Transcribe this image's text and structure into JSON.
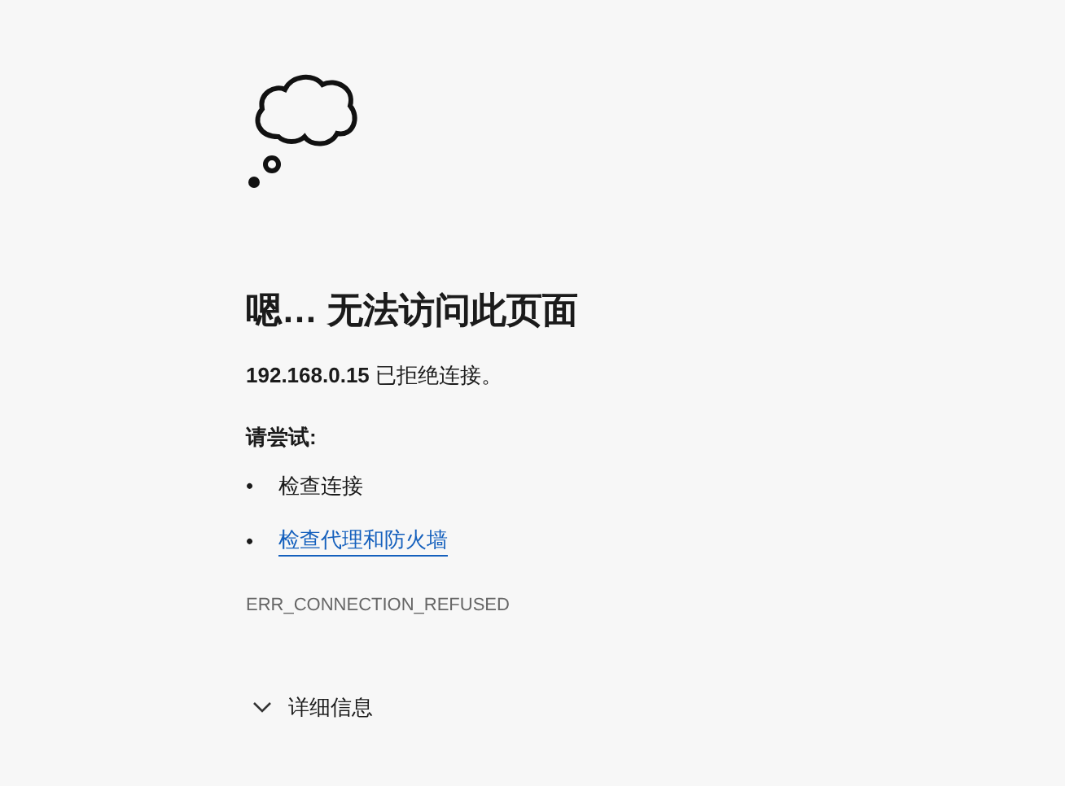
{
  "title": "嗯… 无法访问此页面",
  "message": {
    "host": "192.168.0.15",
    "text": "已拒绝连接。"
  },
  "suggestions_heading": "请尝试:",
  "suggestions": [
    {
      "kind": "text",
      "marker": "•",
      "label": "检查连接"
    },
    {
      "kind": "link",
      "marker": "•",
      "label": "检查代理和防火墙"
    }
  ],
  "error_code": "ERR_CONNECTION_REFUSED",
  "details": {
    "label": "详细信息",
    "expanded": false
  }
}
